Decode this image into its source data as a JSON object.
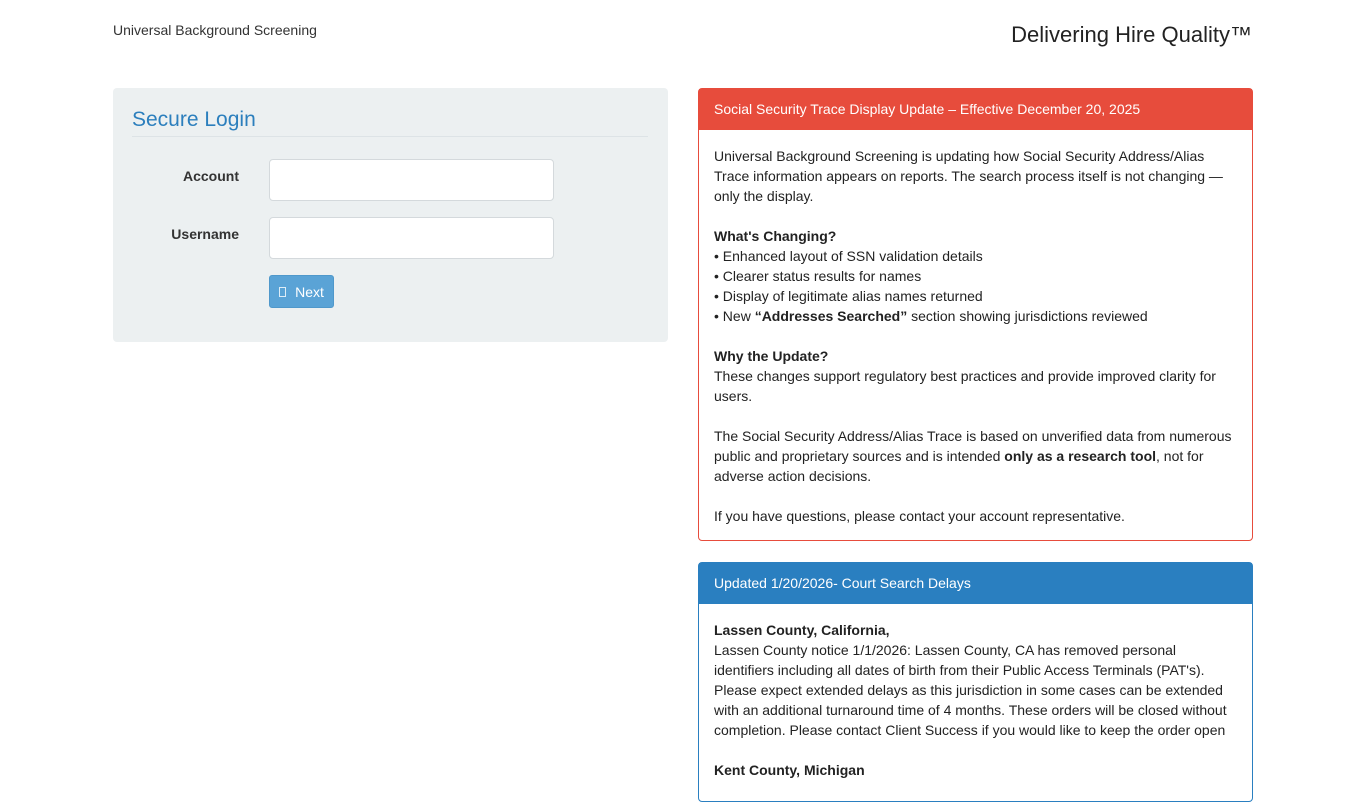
{
  "header": {
    "logo_alt": "Universal Background Screening",
    "tagline": "Delivering Hire Quality™"
  },
  "login": {
    "title": "Secure Login",
    "account_label": "Account",
    "account_value": "",
    "username_label": "Username",
    "username_value": "",
    "next_label": "Next"
  },
  "notice_ssn": {
    "header": "Social Security Trace Display Update – Effective December 20, 2025",
    "intro": "Universal Background Screening is updating how Social Security Address/Alias Trace information appears on reports. The search process itself is not changing — only the display.",
    "changing_heading": "What's Changing?",
    "changes": [
      "• Enhanced layout of SSN validation details",
      "• Clearer status results for names",
      "• Display of legitimate alias names returned"
    ],
    "change_last_prefix": "• New ",
    "change_last_bold": "“Addresses Searched”",
    "change_last_suffix": " section showing jurisdictions reviewed",
    "why_heading": "Why the Update?",
    "why_text": "These changes support regulatory best practices and provide improved clarity for users.",
    "trace_prefix": "The Social Security Address/Alias Trace is based on unverified data from numerous public and proprietary sources and is intended ",
    "trace_bold": "only as a research tool",
    "trace_suffix": ", not for adverse action decisions.",
    "contact": "If you have questions, please contact your account representative."
  },
  "notice_court": {
    "header": "Updated 1/20/2026- Court Search Delays",
    "county1_heading": "Lassen County, California,",
    "county1_text": "Lassen County notice 1/1/2026: Lassen County, CA has removed personal identifiers including all dates of birth from their Public Access Terminals (PAT's). Please expect extended delays as this jurisdiction in some cases can be extended with an additional turnaround time of 4 months. These orders will be closed without completion. Please contact Client Success if you would like to keep the order open",
    "county2_heading": "Kent County, Michigan"
  },
  "colors": {
    "accent_blue": "#2a7fc0",
    "alert_red": "#e74c3c",
    "button_blue": "#5aa3d6",
    "panel_bg": "#ecf0f1"
  }
}
